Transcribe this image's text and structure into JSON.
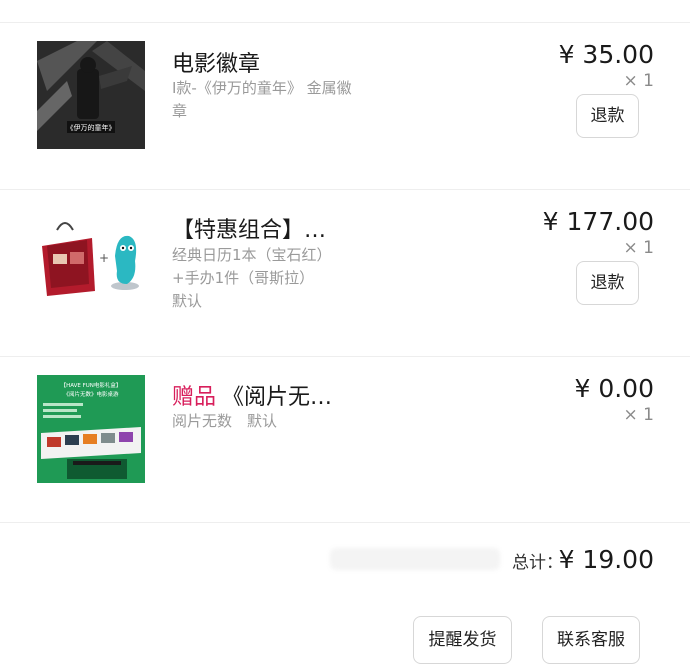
{
  "items": [
    {
      "title": "电影徽章",
      "desc": "I款-《伊万的童年》 金属徽章",
      "price": "¥ 35.00",
      "qty": "× 1",
      "button": "退款",
      "thumb_caption": "《伊万的童年》"
    },
    {
      "title": "【特惠组合】…",
      "desc_lines": [
        "经典日历1本（宝石红）",
        "+手办1件（哥斯拉）",
        "默认"
      ],
      "price": "¥ 177.00",
      "qty": "× 1",
      "button": "退款"
    },
    {
      "gift_label": "赠品",
      "title": "《阅片无…",
      "desc": "阅片无数　默认",
      "price": "¥ 0.00",
      "qty": "× 1",
      "thumb_header": "【HAVE FUN电影礼盒】",
      "thumb_sub": "《阅片无数》电影桌游"
    }
  ],
  "summary": {
    "total_label": "总计：",
    "total_value": "¥ 19.00"
  },
  "actions": {
    "remind_ship": "提醒发货",
    "contact_service": "联系客服"
  },
  "colors": {
    "gift_accent": "#d81e5b",
    "thumb3_green": "#1f9a55",
    "thumb2_red": "#b31b2c"
  }
}
